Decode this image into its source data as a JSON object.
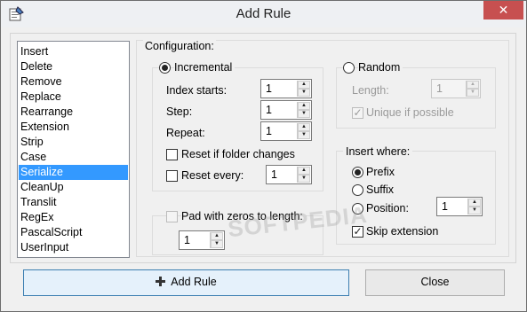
{
  "window": {
    "title": "Add Rule",
    "close_glyph": "✕"
  },
  "rules_list": {
    "items": [
      "Insert",
      "Delete",
      "Remove",
      "Replace",
      "Rearrange",
      "Extension",
      "Strip",
      "Case",
      "Serialize",
      "CleanUp",
      "Translit",
      "RegEx",
      "PascalScript",
      "UserInput"
    ],
    "selected": "Serialize"
  },
  "config": {
    "label": "Configuration:",
    "incremental": {
      "label": "Incremental",
      "selected": true,
      "index_starts": {
        "label": "Index starts:",
        "value": "1"
      },
      "step": {
        "label": "Step:",
        "value": "1"
      },
      "repeat": {
        "label": "Repeat:",
        "value": "1"
      },
      "reset_if_folder_changes": {
        "label": "Reset if folder changes",
        "checked": false
      },
      "reset_every": {
        "label": "Reset every:",
        "checked": false,
        "value": "1"
      }
    },
    "random": {
      "label": "Random",
      "selected": false,
      "length": {
        "label": "Length:",
        "value": "1"
      },
      "unique": {
        "label": "Unique if possible",
        "checked": true
      }
    },
    "pad_zeros": {
      "label": "Pad with zeros to length:",
      "checked": false,
      "value": "1"
    },
    "insert_where": {
      "label": "Insert where:",
      "prefix": {
        "label": "Prefix",
        "selected": true
      },
      "suffix": {
        "label": "Suffix",
        "selected": false
      },
      "position": {
        "label": "Position:",
        "selected": false,
        "value": "1"
      },
      "skip_extension": {
        "label": "Skip extension",
        "checked": true
      }
    }
  },
  "buttons": {
    "add_rule": "Add Rule",
    "close": "Close"
  },
  "watermark": "SOFTPEDIA",
  "icons": {
    "check": "✓",
    "arrow_up": "▲",
    "arrow_down": "▼"
  }
}
